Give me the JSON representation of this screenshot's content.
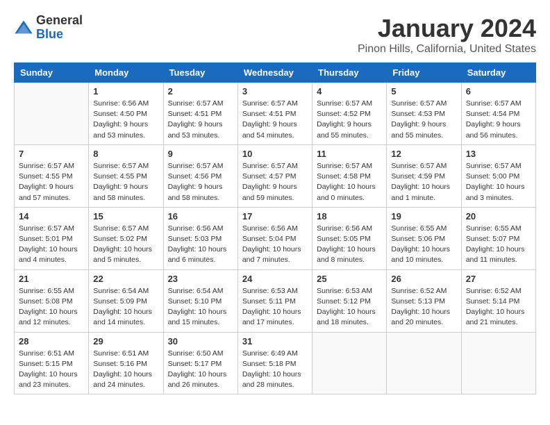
{
  "header": {
    "logo": {
      "general": "General",
      "blue": "Blue"
    },
    "title": "January 2024",
    "location": "Pinon Hills, California, United States"
  },
  "weekdays": [
    "Sunday",
    "Monday",
    "Tuesday",
    "Wednesday",
    "Thursday",
    "Friday",
    "Saturday"
  ],
  "weeks": [
    [
      {
        "day": null
      },
      {
        "day": 1,
        "sunrise": "Sunrise: 6:56 AM",
        "sunset": "Sunset: 4:50 PM",
        "daylight": "Daylight: 9 hours and 53 minutes."
      },
      {
        "day": 2,
        "sunrise": "Sunrise: 6:57 AM",
        "sunset": "Sunset: 4:51 PM",
        "daylight": "Daylight: 9 hours and 53 minutes."
      },
      {
        "day": 3,
        "sunrise": "Sunrise: 6:57 AM",
        "sunset": "Sunset: 4:51 PM",
        "daylight": "Daylight: 9 hours and 54 minutes."
      },
      {
        "day": 4,
        "sunrise": "Sunrise: 6:57 AM",
        "sunset": "Sunset: 4:52 PM",
        "daylight": "Daylight: 9 hours and 55 minutes."
      },
      {
        "day": 5,
        "sunrise": "Sunrise: 6:57 AM",
        "sunset": "Sunset: 4:53 PM",
        "daylight": "Daylight: 9 hours and 55 minutes."
      },
      {
        "day": 6,
        "sunrise": "Sunrise: 6:57 AM",
        "sunset": "Sunset: 4:54 PM",
        "daylight": "Daylight: 9 hours and 56 minutes."
      }
    ],
    [
      {
        "day": 7,
        "sunrise": "Sunrise: 6:57 AM",
        "sunset": "Sunset: 4:55 PM",
        "daylight": "Daylight: 9 hours and 57 minutes."
      },
      {
        "day": 8,
        "sunrise": "Sunrise: 6:57 AM",
        "sunset": "Sunset: 4:55 PM",
        "daylight": "Daylight: 9 hours and 58 minutes."
      },
      {
        "day": 9,
        "sunrise": "Sunrise: 6:57 AM",
        "sunset": "Sunset: 4:56 PM",
        "daylight": "Daylight: 9 hours and 58 minutes."
      },
      {
        "day": 10,
        "sunrise": "Sunrise: 6:57 AM",
        "sunset": "Sunset: 4:57 PM",
        "daylight": "Daylight: 9 hours and 59 minutes."
      },
      {
        "day": 11,
        "sunrise": "Sunrise: 6:57 AM",
        "sunset": "Sunset: 4:58 PM",
        "daylight": "Daylight: 10 hours and 0 minutes."
      },
      {
        "day": 12,
        "sunrise": "Sunrise: 6:57 AM",
        "sunset": "Sunset: 4:59 PM",
        "daylight": "Daylight: 10 hours and 1 minute."
      },
      {
        "day": 13,
        "sunrise": "Sunrise: 6:57 AM",
        "sunset": "Sunset: 5:00 PM",
        "daylight": "Daylight: 10 hours and 3 minutes."
      }
    ],
    [
      {
        "day": 14,
        "sunrise": "Sunrise: 6:57 AM",
        "sunset": "Sunset: 5:01 PM",
        "daylight": "Daylight: 10 hours and 4 minutes."
      },
      {
        "day": 15,
        "sunrise": "Sunrise: 6:57 AM",
        "sunset": "Sunset: 5:02 PM",
        "daylight": "Daylight: 10 hours and 5 minutes."
      },
      {
        "day": 16,
        "sunrise": "Sunrise: 6:56 AM",
        "sunset": "Sunset: 5:03 PM",
        "daylight": "Daylight: 10 hours and 6 minutes."
      },
      {
        "day": 17,
        "sunrise": "Sunrise: 6:56 AM",
        "sunset": "Sunset: 5:04 PM",
        "daylight": "Daylight: 10 hours and 7 minutes."
      },
      {
        "day": 18,
        "sunrise": "Sunrise: 6:56 AM",
        "sunset": "Sunset: 5:05 PM",
        "daylight": "Daylight: 10 hours and 8 minutes."
      },
      {
        "day": 19,
        "sunrise": "Sunrise: 6:55 AM",
        "sunset": "Sunset: 5:06 PM",
        "daylight": "Daylight: 10 hours and 10 minutes."
      },
      {
        "day": 20,
        "sunrise": "Sunrise: 6:55 AM",
        "sunset": "Sunset: 5:07 PM",
        "daylight": "Daylight: 10 hours and 11 minutes."
      }
    ],
    [
      {
        "day": 21,
        "sunrise": "Sunrise: 6:55 AM",
        "sunset": "Sunset: 5:08 PM",
        "daylight": "Daylight: 10 hours and 12 minutes."
      },
      {
        "day": 22,
        "sunrise": "Sunrise: 6:54 AM",
        "sunset": "Sunset: 5:09 PM",
        "daylight": "Daylight: 10 hours and 14 minutes."
      },
      {
        "day": 23,
        "sunrise": "Sunrise: 6:54 AM",
        "sunset": "Sunset: 5:10 PM",
        "daylight": "Daylight: 10 hours and 15 minutes."
      },
      {
        "day": 24,
        "sunrise": "Sunrise: 6:53 AM",
        "sunset": "Sunset: 5:11 PM",
        "daylight": "Daylight: 10 hours and 17 minutes."
      },
      {
        "day": 25,
        "sunrise": "Sunrise: 6:53 AM",
        "sunset": "Sunset: 5:12 PM",
        "daylight": "Daylight: 10 hours and 18 minutes."
      },
      {
        "day": 26,
        "sunrise": "Sunrise: 6:52 AM",
        "sunset": "Sunset: 5:13 PM",
        "daylight": "Daylight: 10 hours and 20 minutes."
      },
      {
        "day": 27,
        "sunrise": "Sunrise: 6:52 AM",
        "sunset": "Sunset: 5:14 PM",
        "daylight": "Daylight: 10 hours and 21 minutes."
      }
    ],
    [
      {
        "day": 28,
        "sunrise": "Sunrise: 6:51 AM",
        "sunset": "Sunset: 5:15 PM",
        "daylight": "Daylight: 10 hours and 23 minutes."
      },
      {
        "day": 29,
        "sunrise": "Sunrise: 6:51 AM",
        "sunset": "Sunset: 5:16 PM",
        "daylight": "Daylight: 10 hours and 24 minutes."
      },
      {
        "day": 30,
        "sunrise": "Sunrise: 6:50 AM",
        "sunset": "Sunset: 5:17 PM",
        "daylight": "Daylight: 10 hours and 26 minutes."
      },
      {
        "day": 31,
        "sunrise": "Sunrise: 6:49 AM",
        "sunset": "Sunset: 5:18 PM",
        "daylight": "Daylight: 10 hours and 28 minutes."
      },
      {
        "day": null
      },
      {
        "day": null
      },
      {
        "day": null
      }
    ]
  ]
}
